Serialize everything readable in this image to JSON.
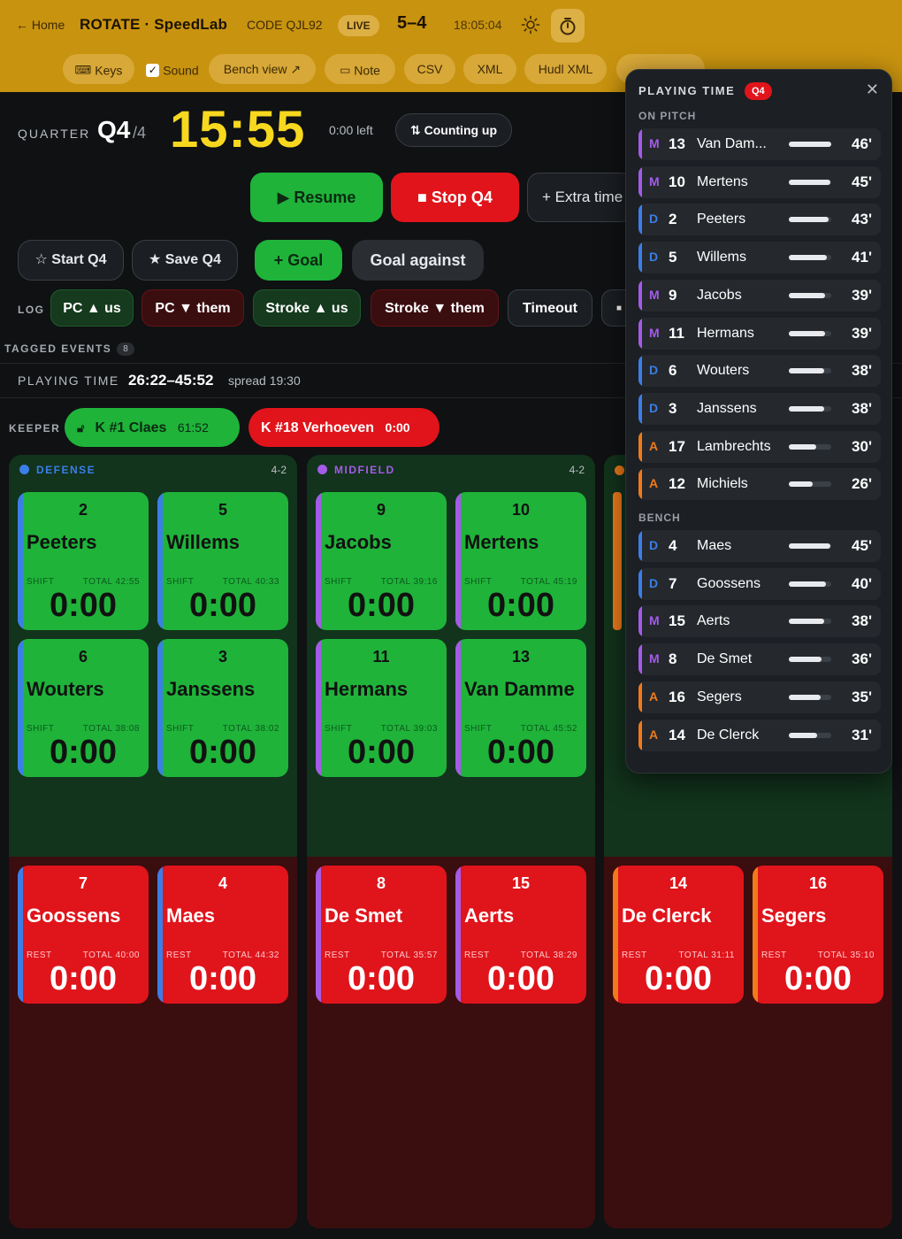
{
  "header": {
    "home": "← Home",
    "title": "ROTATE · SpeedLab",
    "code": "CODE QJL92",
    "live": "LIVE",
    "score": "5–4",
    "clock": "18:05:04"
  },
  "toolbar": {
    "keys": "Keys",
    "sound": "Sound",
    "bench_view": "Bench view ↗",
    "note": "Note",
    "csv": "CSV",
    "xml": "XML",
    "hudl": "Hudl XML"
  },
  "quarter": {
    "label": "QUARTER",
    "value": "Q4",
    "of": "/4",
    "time": "15:55",
    "left": "0:00 left",
    "counting": "⇅ Counting up"
  },
  "controls": {
    "resume": "▶ Resume",
    "stop": "■ Stop Q4",
    "extra": "+ Extra time",
    "start": "☆ Start Q4",
    "save": "★ Save Q4",
    "goal": "+ Goal",
    "goal_against": "Goal against"
  },
  "log": {
    "label": "LOG",
    "items": [
      "PC ▲ us",
      "PC ▼ them",
      "Stroke ▲ us",
      "Stroke ▼ them",
      "Timeout",
      "■"
    ]
  },
  "tagged": {
    "label": "TAGGED EVENTS",
    "count": "8"
  },
  "playing_time": {
    "label": "PLAYING TIME",
    "range": "26:22–45:52",
    "spread": "spread 19:30"
  },
  "keepers": {
    "label": "KEEPER",
    "active": "K  #1  Claes",
    "active_time": "61:52",
    "bench": "K  #18  Verhoeven",
    "bench_time": "0:00"
  },
  "panels": [
    {
      "name": "DEFENSE",
      "formation": "4-2",
      "color": "#3b7ee8",
      "on": [
        {
          "num": "2",
          "name": "Peeters",
          "shift": "SHIFT",
          "total": "TOTAL 42:55",
          "time": "0:00"
        },
        {
          "num": "5",
          "name": "Willems",
          "shift": "SHIFT",
          "total": "TOTAL 40:33",
          "time": "0:00"
        },
        {
          "num": "6",
          "name": "Wouters",
          "shift": "SHIFT",
          "total": "TOTAL 38:08",
          "time": "0:00"
        },
        {
          "num": "3",
          "name": "Janssens",
          "shift": "SHIFT",
          "total": "TOTAL 38:02",
          "time": "0:00"
        }
      ],
      "off": [
        {
          "num": "7",
          "name": "Goossens",
          "shift": "REST",
          "total": "TOTAL 40:00",
          "time": "0:00"
        },
        {
          "num": "4",
          "name": "Maes",
          "shift": "REST",
          "total": "TOTAL 44:32",
          "time": "0:00"
        }
      ]
    },
    {
      "name": "MIDFIELD",
      "formation": "4-2",
      "color": "#a45be8",
      "on": [
        {
          "num": "9",
          "name": "Jacobs",
          "shift": "SHIFT",
          "total": "TOTAL 39:16",
          "time": "0:00"
        },
        {
          "num": "10",
          "name": "Mertens",
          "shift": "SHIFT",
          "total": "TOTAL 45:19",
          "time": "0:00"
        },
        {
          "num": "11",
          "name": "Hermans",
          "shift": "SHIFT",
          "total": "TOTAL 39:03",
          "time": "0:00"
        },
        {
          "num": "13",
          "name": "Van Damme",
          "shift": "SHIFT",
          "total": "TOTAL 45:52",
          "time": "0:00"
        }
      ],
      "off": [
        {
          "num": "8",
          "name": "De Smet",
          "shift": "REST",
          "total": "TOTAL 35:57",
          "time": "0:00"
        },
        {
          "num": "15",
          "name": "Aerts",
          "shift": "REST",
          "total": "TOTAL 38:29",
          "time": "0:00"
        }
      ]
    },
    {
      "name": "",
      "formation": "",
      "color": "#f07a1a",
      "on": [],
      "off": [
        {
          "num": "14",
          "name": "De Clerck",
          "shift": "REST",
          "total": "TOTAL 31:11",
          "time": "0:00"
        },
        {
          "num": "16",
          "name": "Segers",
          "shift": "REST",
          "total": "TOTAL 35:10",
          "time": "0:00"
        }
      ]
    }
  ],
  "popup": {
    "title": "PLAYING TIME",
    "badge": "Q4",
    "on_pitch_label": "ON PITCH",
    "bench_label": "BENCH",
    "on_pitch": [
      {
        "pos": "M",
        "num": "13",
        "name": "Van Dam...",
        "min": "46'",
        "pct": 1.0
      },
      {
        "pos": "M",
        "num": "10",
        "name": "Mertens",
        "min": "45'",
        "pct": 0.98
      },
      {
        "pos": "D",
        "num": "2",
        "name": "Peeters",
        "min": "43'",
        "pct": 0.93
      },
      {
        "pos": "D",
        "num": "5",
        "name": "Willems",
        "min": "41'",
        "pct": 0.89
      },
      {
        "pos": "M",
        "num": "9",
        "name": "Jacobs",
        "min": "39'",
        "pct": 0.85
      },
      {
        "pos": "M",
        "num": "11",
        "name": "Hermans",
        "min": "39'",
        "pct": 0.85
      },
      {
        "pos": "D",
        "num": "6",
        "name": "Wouters",
        "min": "38'",
        "pct": 0.83
      },
      {
        "pos": "D",
        "num": "3",
        "name": "Janssens",
        "min": "38'",
        "pct": 0.83
      },
      {
        "pos": "A",
        "num": "17",
        "name": "Lambrechts",
        "min": "30'",
        "pct": 0.65
      },
      {
        "pos": "A",
        "num": "12",
        "name": "Michiels",
        "min": "26'",
        "pct": 0.57
      }
    ],
    "bench": [
      {
        "pos": "D",
        "num": "4",
        "name": "Maes",
        "min": "45'",
        "pct": 0.98
      },
      {
        "pos": "D",
        "num": "7",
        "name": "Goossens",
        "min": "40'",
        "pct": 0.87
      },
      {
        "pos": "M",
        "num": "15",
        "name": "Aerts",
        "min": "38'",
        "pct": 0.83
      },
      {
        "pos": "M",
        "num": "8",
        "name": "De Smet",
        "min": "36'",
        "pct": 0.78
      },
      {
        "pos": "A",
        "num": "16",
        "name": "Segers",
        "min": "35'",
        "pct": 0.76
      },
      {
        "pos": "A",
        "num": "14",
        "name": "De Clerck",
        "min": "31'",
        "pct": 0.67
      }
    ]
  },
  "colors": {
    "D": "#3b7ee8",
    "M": "#a45be8",
    "A": "#f07a1a"
  }
}
